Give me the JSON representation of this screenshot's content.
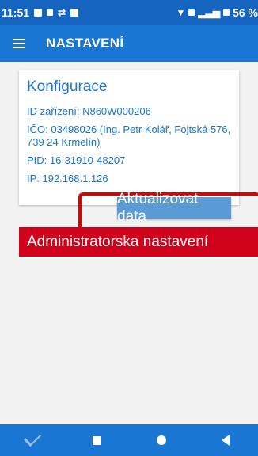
{
  "status_bar": {
    "time": "11:51",
    "battery": "56 %",
    "icons": [
      "gallery-icon",
      "lock-icon",
      "sync-icon",
      "image-icon",
      "wifi-icon",
      "signal-icon",
      "battery-icon"
    ]
  },
  "app_bar": {
    "title": "NASTAVENÍ",
    "menu_icon": "hamburger-menu-icon"
  },
  "card": {
    "title": "Konfigurace",
    "device_id": "ID zařízení: N860W000206",
    "ico": "IČO: 03498026 (Ing. Petr Kolář, Fojtská 576, 739 24 Krmelín)",
    "pid": "PID: 16-31910-48207",
    "ip": "IP: 192.168.1.126",
    "update_button": "Aktualizovat data"
  },
  "admin_button": "Administratorska nastavení",
  "nav_bar": {
    "icons": [
      "chevron-down-icon",
      "recents-icon",
      "home-icon",
      "back-icon"
    ]
  },
  "colors": {
    "status_bar": "#1565c0",
    "app_bar": "#1976d2",
    "accent_text": "#1976d2",
    "update_button": "#5b9bd5",
    "admin_banner": "#d0021b",
    "annotation": "#e00000"
  }
}
